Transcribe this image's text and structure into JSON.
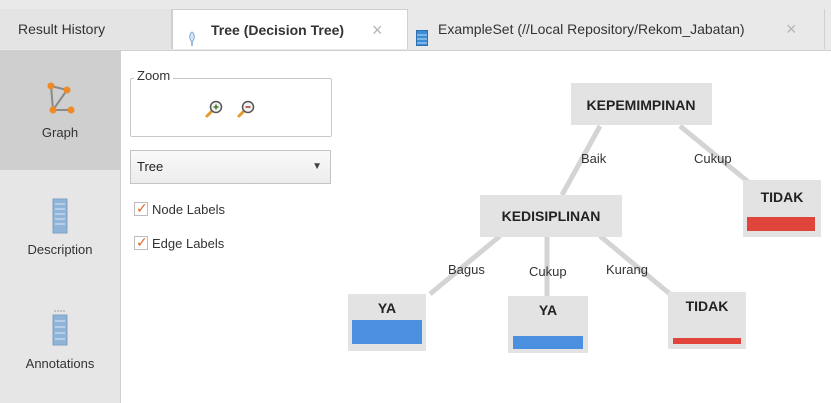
{
  "tabs": [
    {
      "label": "Result History"
    },
    {
      "label": "Tree (Decision Tree)",
      "close": "×"
    },
    {
      "label": "ExampleSet (//Local Repository/Rekom_Jabatan)",
      "close": "×"
    }
  ],
  "views": [
    {
      "label": "Graph",
      "icon": "graph-icon"
    },
    {
      "label": "Description",
      "icon": "description-icon"
    },
    {
      "label": "Annotations",
      "icon": "annotations-icon"
    }
  ],
  "options": {
    "zoom_label": "Zoom",
    "layout_value": "Tree",
    "node_labels": "Node Labels",
    "edge_labels": "Edge Labels"
  },
  "colors": {
    "accent": "#e06a25",
    "class_ya": "#4a8fe0",
    "class_tidak": "#e0443a",
    "node_bg": "#e3e3e3"
  },
  "tree": {
    "root": "KEPEMIMPINAN",
    "inner": "KEDISIPLINAN",
    "leaves": [
      "TIDAK",
      "YA",
      "YA",
      "TIDAK"
    ],
    "edges": [
      "Baik",
      "Cukup",
      "Bagus",
      "Cukup",
      "Kurang"
    ]
  }
}
